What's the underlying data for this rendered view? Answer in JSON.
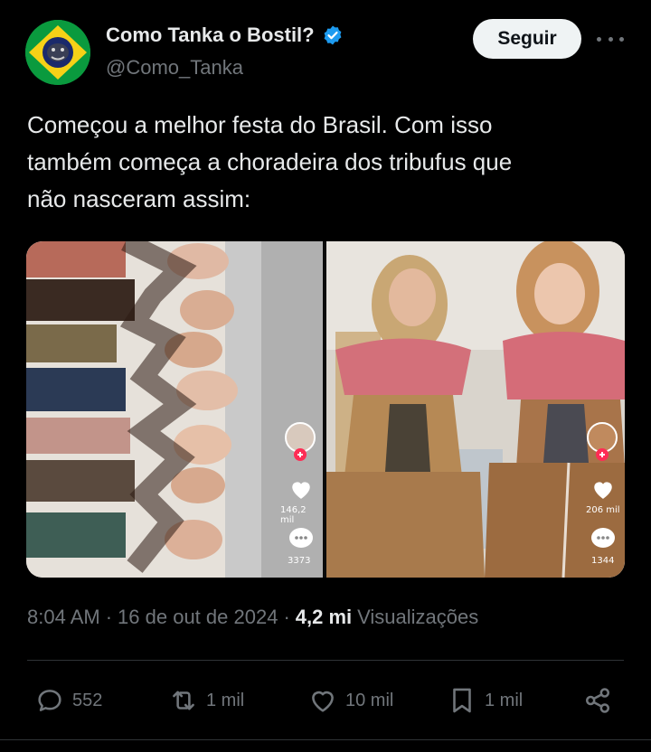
{
  "author": {
    "display_name": "Como Tanka o Bostil?",
    "handle": "@Como_Tanka",
    "verified": true,
    "avatar_icon": "brazil-flag-avatar"
  },
  "follow_label": "Seguir",
  "more_icon": "more-options-icon",
  "tweet": {
    "line1": "Começou a melhor festa do Brasil. Com isso",
    "line2": "também começa a choradeira dos tribufus que",
    "line3": "não nasceram assim:"
  },
  "media": {
    "left": {
      "likes": "146,2 mil",
      "comments": "3373"
    },
    "right": {
      "likes": "206 mil",
      "comments": "1344"
    }
  },
  "meta": {
    "time": "8:04 AM",
    "dot1": "·",
    "date": "16 de out de 2024",
    "dot2": "·",
    "views_count": "4,2 mi",
    "views_label": "Visualizações"
  },
  "actions": {
    "replies": "552",
    "reposts": "1 mil",
    "likes": "10 mil",
    "bookmarks": "1 mil"
  },
  "colors": {
    "background": "#000000",
    "text": "#e7e9ea",
    "muted": "#71767b",
    "verified": "#1d9bf0",
    "follow_bg": "#eff3f4"
  }
}
